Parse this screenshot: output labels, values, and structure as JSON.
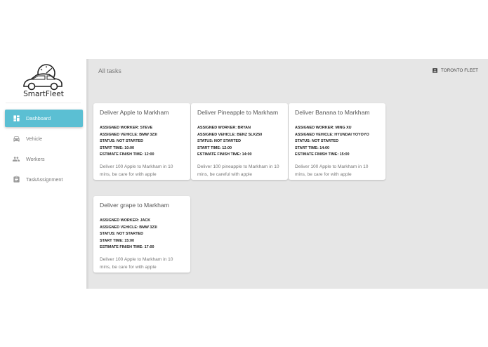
{
  "brand": {
    "name": "SmartFleet"
  },
  "nav": [
    {
      "label": "Dashboard",
      "icon": "dashboard-icon",
      "active": true
    },
    {
      "label": "Vehicle",
      "icon": "car-icon",
      "active": false
    },
    {
      "label": "Workers",
      "icon": "people-icon",
      "active": false
    },
    {
      "label": "TaskAssignment",
      "icon": "assignment-icon",
      "active": false
    }
  ],
  "header": {
    "title": "All tasks",
    "company": "TORONTO FLEET"
  },
  "tasks": [
    {
      "title": "Deliver Apple to Markham",
      "worker": "ASSIGNED WORKER: STEVE",
      "vehicle": "ASSIGNED VEHICLE: BMW 323I",
      "status": "STATUS: NOT STARTED",
      "start": "START TIME: 10:00",
      "finish": "ESTIMATE FINISH TIME: 12:00",
      "description": "Deliver 100 Apple to Markham in 10 mins, be care for with apple"
    },
    {
      "title": "Deliver Pineapple to Markham",
      "worker": "ASSIGNED WORKER: BRYAN",
      "vehicle": "ASSIGNED VEHICLE: BENZ SLK250",
      "status": "STATUS: NOT STARTED",
      "start": "START TIME: 12:00",
      "finish": "ESTIMATE FINISH TIME: 14:00",
      "description": "Deliver 100 pineapple to Markham in 10 mins, be careful with apple"
    },
    {
      "title": "Deliver Banana to Markham",
      "worker": "ASSIGNED WORKER: MING XU",
      "vehicle": "ASSIGNED VEHICLE: HYUNDAI YOYOYO",
      "status": "STATUS: NOT STARTED",
      "start": "START TIME: 14:00",
      "finish": "ESTIMATE FINISH TIME: 15:00",
      "description": "Deliver 100 Apple to Markham in 10 mins, be care for with apple"
    },
    {
      "title": "Deliver grape to Markham",
      "worker": "ASSIGNED WORKER: JACK",
      "vehicle": "ASSIGNED VEHICLE: BMW 323I",
      "status": "STATUS: NOT STARTED",
      "start": "START TIME: 15:00",
      "finish": "ESTIMATE FINISH TIME: 17:00",
      "description": "Deliver 100 Apple to Markham in 10 mins, be care for with apple"
    }
  ],
  "colors": {
    "accent": "#5bbfd3",
    "main_bg": "#e6e6e6"
  }
}
